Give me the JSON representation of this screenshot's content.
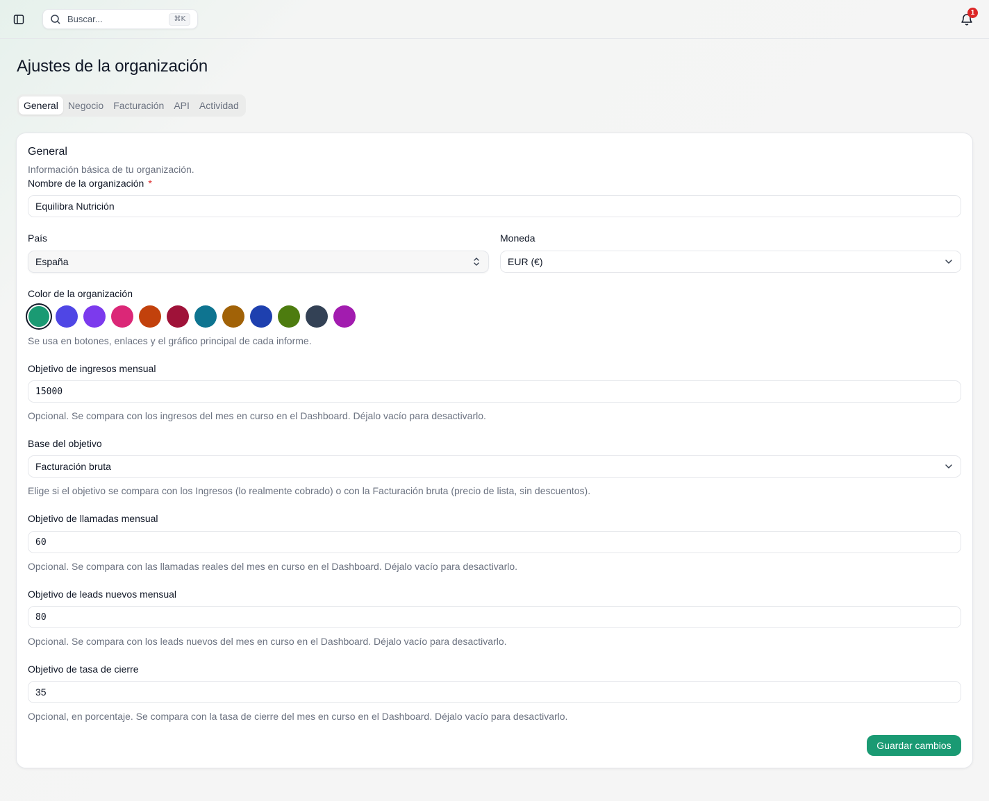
{
  "topbar": {
    "search_placeholder": "Buscar...",
    "search_shortcut": "⌘K",
    "notifications_count": "1"
  },
  "page": {
    "title": "Ajustes de la organización"
  },
  "tabs": [
    {
      "label": "General",
      "active": true
    },
    {
      "label": "Negocio",
      "active": false
    },
    {
      "label": "Facturación",
      "active": false
    },
    {
      "label": "API",
      "active": false
    },
    {
      "label": "Actividad",
      "active": false
    }
  ],
  "card": {
    "title": "General",
    "description": "Información básica de tu organización.",
    "org_name": {
      "label": "Nombre de la organización",
      "required_mark": "*",
      "value": "Equilibra Nutrición"
    },
    "country": {
      "label": "País",
      "value": "España"
    },
    "currency": {
      "label": "Moneda",
      "value": "EUR (€)"
    },
    "color": {
      "label": "Color de la organización",
      "help": "Se usa en botones, enlaces y el gráfico principal de cada informe.",
      "swatches": [
        "#1a9a73",
        "#4f46e5",
        "#7c3aed",
        "#db2777",
        "#c2410c",
        "#9f1239",
        "#0e7490",
        "#a16207",
        "#1e40af",
        "#4d7c0f",
        "#334155",
        "#a21caf"
      ],
      "selected_index": 0
    },
    "revenue_goal": {
      "label": "Objetivo de ingresos mensual",
      "value": "15000",
      "help": "Opcional. Se compara con los ingresos del mes en curso en el Dashboard. Déjalo vacío para desactivarlo."
    },
    "goal_basis": {
      "label": "Base del objetivo",
      "value": "Facturación bruta",
      "help": "Elige si el objetivo se compara con los Ingresos (lo realmente cobrado) o con la Facturación bruta (precio de lista, sin descuentos)."
    },
    "calls_goal": {
      "label": "Objetivo de llamadas mensual",
      "value": "60",
      "help": "Opcional. Se compara con las llamadas reales del mes en curso en el Dashboard. Déjalo vacío para desactivarlo."
    },
    "leads_goal": {
      "label": "Objetivo de leads nuevos mensual",
      "value": "80",
      "help": "Opcional. Se compara con los leads nuevos del mes en curso en el Dashboard. Déjalo vacío para desactivarlo."
    },
    "close_rate_goal": {
      "label": "Objetivo de tasa de cierre",
      "value": "35",
      "help": "Opcional, en porcentaje. Se compara con la tasa de cierre del mes en curso en el Dashboard. Déjalo vacío para desactivarlo."
    },
    "save_label": "Guardar cambios"
  }
}
